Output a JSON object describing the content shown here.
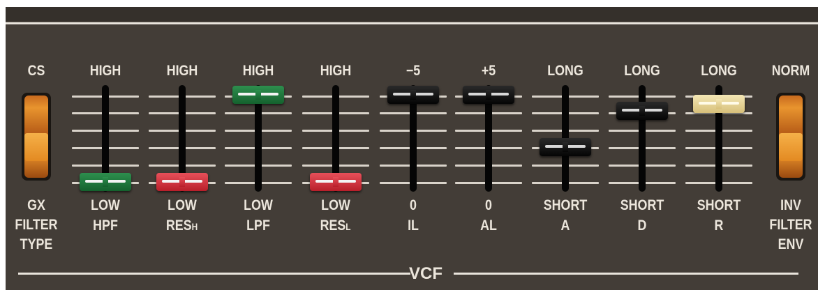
{
  "section": {
    "title": "VCF"
  },
  "switches": [
    {
      "id": "filter-type",
      "top_label": "CS",
      "bottom_lines": [
        "GX",
        "FILTER",
        "TYPE"
      ],
      "position": "down"
    },
    {
      "id": "filter-env",
      "top_label": "NORM",
      "bottom_lines": [
        "INV",
        "FILTER",
        "ENV"
      ],
      "position": "down"
    }
  ],
  "sliders": [
    {
      "id": "hpf",
      "top_label": "HIGH",
      "bottom_label": "LOW",
      "name": "HPF",
      "name_sub": "",
      "color": "green",
      "level": 0.0
    },
    {
      "id": "res-h",
      "top_label": "HIGH",
      "bottom_label": "LOW",
      "name": "RES",
      "name_sub": "H",
      "color": "red",
      "level": 0.0
    },
    {
      "id": "lpf",
      "top_label": "HIGH",
      "bottom_label": "LOW",
      "name": "LPF",
      "name_sub": "",
      "color": "green",
      "level": 1.0
    },
    {
      "id": "res-l",
      "top_label": "HIGH",
      "bottom_label": "LOW",
      "name": "RES",
      "name_sub": "L",
      "color": "red",
      "level": 0.0
    },
    {
      "id": "il",
      "top_label": "−5",
      "bottom_label": "0",
      "name": "IL",
      "name_sub": "",
      "color": "black",
      "level": 1.0
    },
    {
      "id": "al",
      "top_label": "+5",
      "bottom_label": "0",
      "name": "AL",
      "name_sub": "",
      "color": "black",
      "level": 1.0
    },
    {
      "id": "a",
      "top_label": "LONG",
      "bottom_label": "SHORT",
      "name": "A",
      "name_sub": "",
      "color": "black",
      "level": 0.4
    },
    {
      "id": "d",
      "top_label": "LONG",
      "bottom_label": "SHORT",
      "name": "D",
      "name_sub": "",
      "color": "black",
      "level": 0.82
    },
    {
      "id": "r",
      "top_label": "LONG",
      "bottom_label": "SHORT",
      "name": "R",
      "name_sub": "",
      "color": "cream",
      "level": 0.9
    }
  ],
  "colors": {
    "panel": "#433d37",
    "label": "#ece6dc",
    "green": "#1f7a3e",
    "red": "#d8323c",
    "black": "#0b0b0b",
    "cream": "#e9d79a",
    "orange": "#e8942e"
  }
}
